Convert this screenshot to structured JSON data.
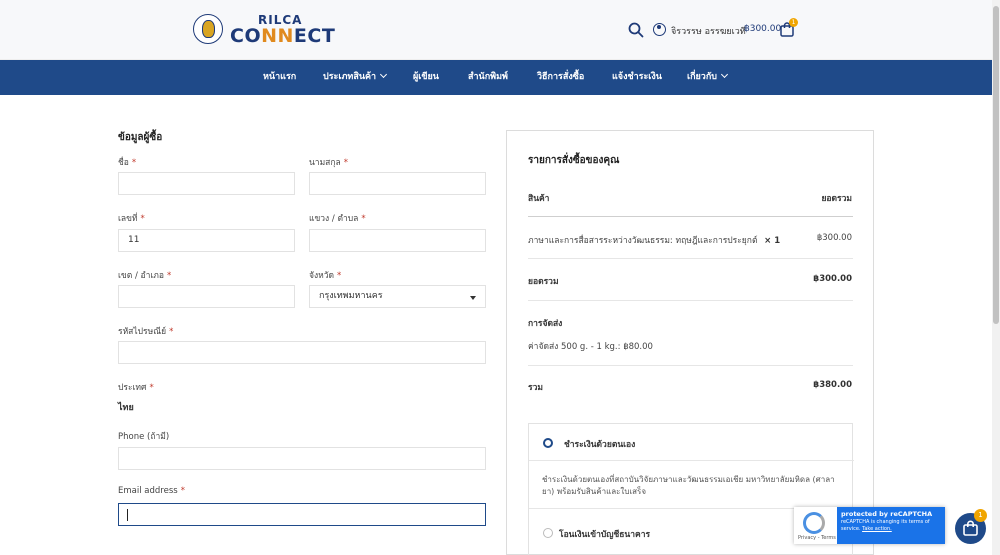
{
  "brand": {
    "logo_top": "RILCA",
    "logo_bottom_1": "CO",
    "logo_bottom_2": "NN",
    "logo_bottom_3": "ECT"
  },
  "header": {
    "username": "จิรวรรษ อรรฆยเวที",
    "cart_total": "฿300.00",
    "cart_count": "1"
  },
  "nav": {
    "items": [
      {
        "label": "หน้าแรก",
        "has_dropdown": false
      },
      {
        "label": "ประเภทสินค้า",
        "has_dropdown": true
      },
      {
        "label": "ผู้เขียน",
        "has_dropdown": false
      },
      {
        "label": "สำนักพิมพ์",
        "has_dropdown": false
      },
      {
        "label": "วิธีการสั่งซื้อ",
        "has_dropdown": false
      },
      {
        "label": "แจ้งชำระเงิน",
        "has_dropdown": false
      },
      {
        "label": "เกี่ยวกับ",
        "has_dropdown": true
      }
    ]
  },
  "billing": {
    "title": "ข้อมูลผู้ซื้อ",
    "required_mark": "*",
    "first_name": {
      "label": "ชื่อ",
      "value": ""
    },
    "last_name": {
      "label": "นามสกุล",
      "value": ""
    },
    "house_no": {
      "label": "เลขที่",
      "value": "11"
    },
    "subdistrict": {
      "label": "แขวง / ตำบล",
      "value": ""
    },
    "district": {
      "label": "เขต / อำเภอ",
      "value": ""
    },
    "province": {
      "label": "จังหวัด",
      "value": "กรุงเทพมหานคร"
    },
    "postcode": {
      "label": "รหัสไปรษณีย์",
      "value": ""
    },
    "country": {
      "label": "ประเทศ",
      "value": "ไทย"
    },
    "phone": {
      "label": "Phone (ถ้ามี)",
      "value": ""
    },
    "email": {
      "label": "Email address",
      "value": ""
    }
  },
  "order": {
    "title": "รายการสั่งซื้อของคุณ",
    "col_product": "สินค้า",
    "col_total": "ยอดรวม",
    "item_name": "ภาษาและการสื่อสารระหว่างวัฒนธรรม: ทฤษฎีและการประยุกต์",
    "item_qty": "× 1",
    "item_price": "฿300.00",
    "subtotal_label": "ยอดรวม",
    "subtotal_value": "฿300.00",
    "shipping_label": "การจัดส่ง",
    "shipping_method": "ค่าจัดส่ง 500 g. - 1 kg.: ฿80.00",
    "total_label": "รวม",
    "total_value": "฿380.00"
  },
  "payment": {
    "option1_label": "ชำระเงินด้วยตนเอง",
    "option1_desc": "ชำระเงินด้วยตนเองที่สถาบันวิจัยภาษาและวัฒนธรรมเอเชีย มหาวิทยาลัยมหิดล (ศาลายา) พร้อมรับสินค้าและใบเสร็จ",
    "option2_label": "โอนเงินเข้าบัญชีธนาคาร"
  },
  "recaptcha": {
    "line1": "protected by reCAPTCHA",
    "line2": "reCAPTCHA is changing its terms of service.",
    "link": "Take action.",
    "footer": "Privacy - Terms"
  },
  "floating_cart": {
    "count": "1"
  }
}
